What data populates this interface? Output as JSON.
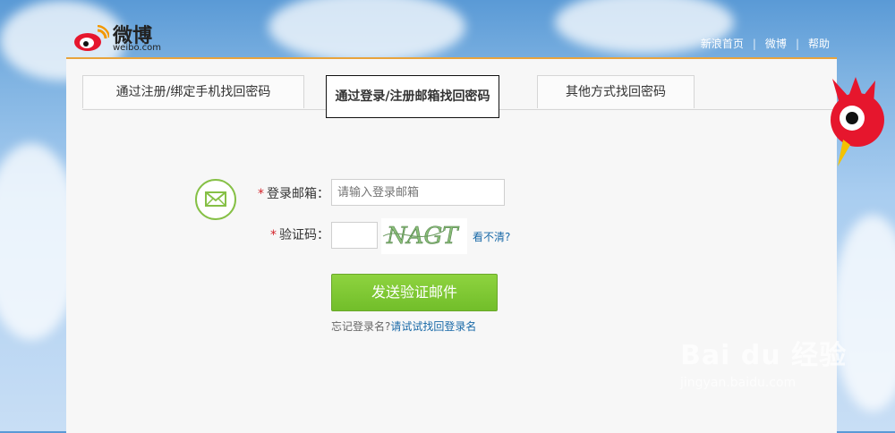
{
  "header": {
    "logo_text": "微博",
    "logo_sub": "weibo.com",
    "links": [
      "新浪首页",
      "微博",
      "帮助"
    ]
  },
  "tabs": [
    {
      "label": "通过注册/绑定手机找回密码",
      "active": false
    },
    {
      "label": "通过登录/注册邮箱找回密码",
      "active": true
    },
    {
      "label": "其他方式找回密码",
      "active": false
    }
  ],
  "form": {
    "required_mark": "*",
    "email_label": "登录邮箱：",
    "email_placeholder": "请输入登录邮箱",
    "email_value": "",
    "captcha_label": "验证码：",
    "captcha_value": "",
    "captcha_text": "NAGT",
    "captcha_refresh": "看不清?",
    "submit_label": "发送验证邮件",
    "forgot_prefix": "忘记登录名?",
    "forgot_link": "请试试找回登录名"
  },
  "watermark": {
    "brand": "Bai du 经验",
    "url": "jingyan.baidu.com"
  },
  "colors": {
    "accent_orange": "#e8a33c",
    "button_green": "#7dc735",
    "link_blue": "#1a6aa8",
    "required_red": "#d4232a"
  },
  "icons": [
    "weibo-logo-icon",
    "mail-icon",
    "weibo-mascot-icon"
  ]
}
